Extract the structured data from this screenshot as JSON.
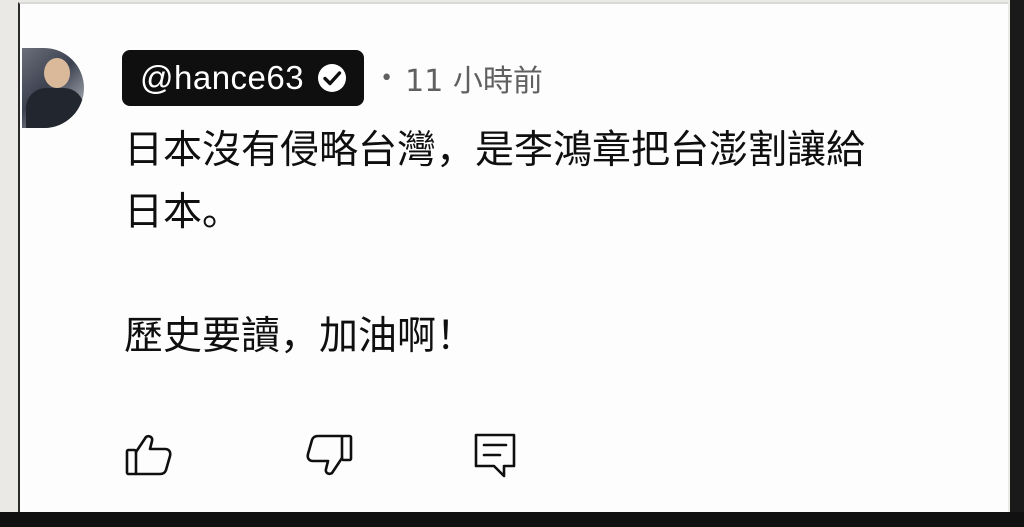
{
  "comment": {
    "author_handle": "@hance63",
    "verified": true,
    "separator": "•",
    "timestamp": "11 小時前",
    "lines": [
      "日本沒有侵略台灣，是李鴻章把台澎割讓給",
      "日本。",
      "",
      "歷史要讀，加油啊！"
    ]
  },
  "actions": {
    "like_icon": "thumbs-up-icon",
    "dislike_icon": "thumbs-down-icon",
    "reply_icon": "reply-comment-icon"
  },
  "colors": {
    "pill_bg": "#0f0f0f",
    "text": "#0f0f0f",
    "meta": "#606060"
  }
}
